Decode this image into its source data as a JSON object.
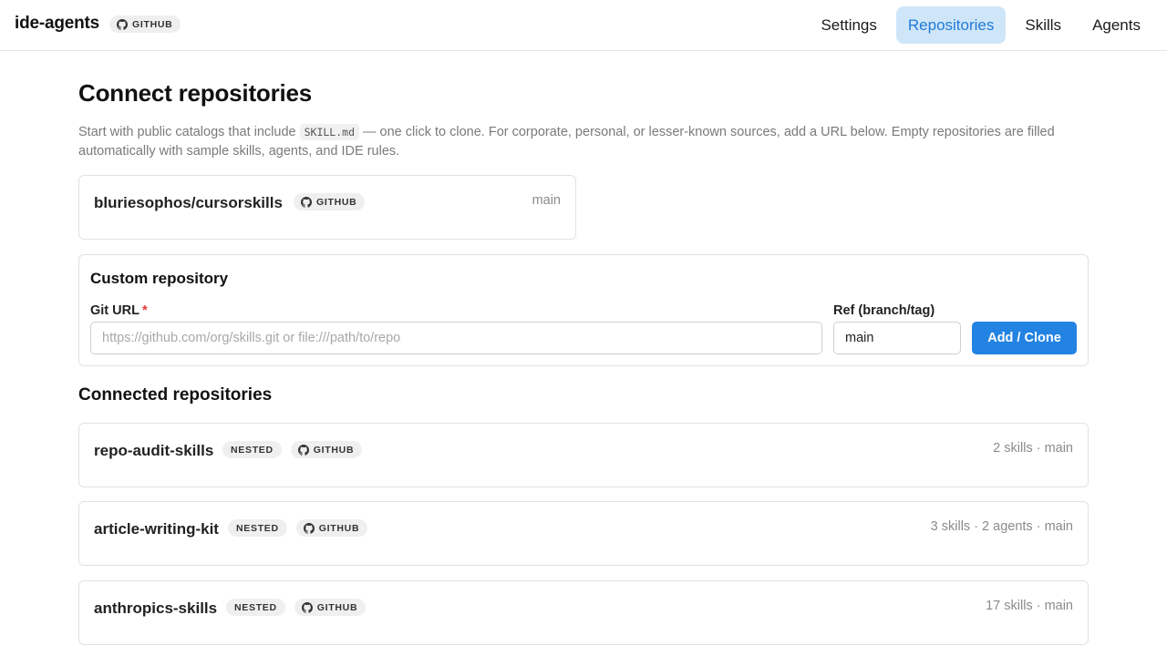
{
  "app": {
    "name": "ide-agents",
    "badge": "GITHUB"
  },
  "nav": [
    {
      "label": "Settings",
      "active": false
    },
    {
      "label": "Repositories",
      "active": true
    },
    {
      "label": "Skills",
      "active": false
    },
    {
      "label": "Agents",
      "active": false
    }
  ],
  "page": {
    "title": "Connect repositories",
    "intro_before": "Start with public catalogs that include ",
    "intro_code": "SKILL.md",
    "intro_after": " — one click to clone. For corporate, personal, or lesser-known sources, add a URL below. Empty repositories are filled automatically with sample skills, agents, and IDE rules."
  },
  "catalog": [
    {
      "name": "bluriesophos/cursorskills",
      "badge": "GITHUB",
      "meta": "main"
    }
  ],
  "custom": {
    "title": "Custom repository",
    "git_url_label": "Git URL",
    "required_mark": "*",
    "git_url_placeholder": "https://github.com/org/skills.git or file:///path/to/repo",
    "git_url_value": "",
    "ref_label": "Ref (branch/tag)",
    "ref_value": "main",
    "submit_label": "Add / Clone"
  },
  "connected": {
    "title": "Connected repositories",
    "items": [
      {
        "name": "repo-audit-skills",
        "nested": "NESTED",
        "badge": "GITHUB",
        "meta": "2 skills · main"
      },
      {
        "name": "article-writing-kit",
        "nested": "NESTED",
        "badge": "GITHUB",
        "meta": "3 skills · 2 agents · main"
      },
      {
        "name": "anthropics-skills",
        "nested": "NESTED",
        "badge": "GITHUB",
        "meta": "17 skills · main"
      }
    ]
  },
  "colors": {
    "accent": "#2383e2",
    "active_nav_bg": "#cfe6f9",
    "required": "#e53935"
  },
  "icons": {
    "github": "github-icon"
  }
}
